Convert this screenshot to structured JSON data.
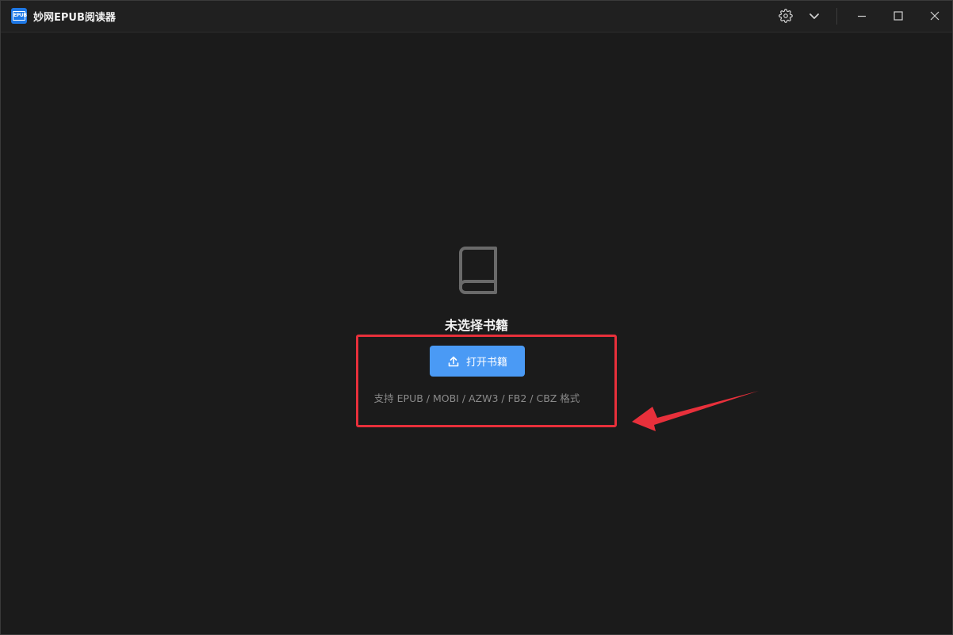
{
  "window": {
    "title": "妙网EPUB阅读器",
    "logo_text": "EPUB"
  },
  "titlebar": {
    "icons": [
      "gear-icon",
      "chevron-down-icon",
      "minimize-icon",
      "maximize-icon",
      "close-icon"
    ]
  },
  "empty_state": {
    "icon": "book-icon",
    "title": "未选择书籍",
    "open_button_label": "打开书籍",
    "open_button_icon": "upload-icon",
    "formats_hint": "支持 EPUB / MOBI / AZW3 / FB2 / CBZ 格式"
  },
  "colors": {
    "background": "#1b1b1b",
    "titlebar": "#202020",
    "accent": "#4a9af5",
    "logo": "#1e78e6",
    "annotation": "#e8303b",
    "muted_text": "#8a8a8a"
  }
}
